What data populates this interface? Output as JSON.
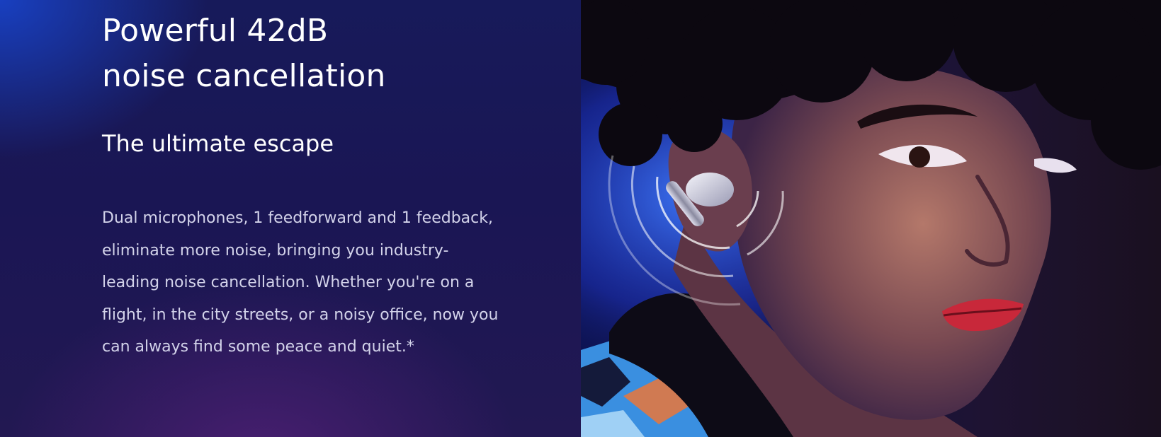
{
  "hero": {
    "headline_line1": "Powerful 42dB",
    "headline_line2": "noise cancellation",
    "subheadline": "The ultimate escape",
    "description": "Dual microphones, 1 feedforward and 1 feedback, eliminate more noise, bringing you industry-leading noise cancellation. Whether you're on a flight, in the city streets, or a noisy office, now you can always find some peace and quiet.*"
  },
  "photo": {
    "subject": "woman-wearing-earbud",
    "icon": "sound-wave-icon"
  },
  "colors": {
    "panel_background": "#1a1654",
    "headline_text": "#ffffff",
    "body_text": "#d3d3ea",
    "lip_red": "#c8283a",
    "ambient_blue": "#2f5cff"
  }
}
